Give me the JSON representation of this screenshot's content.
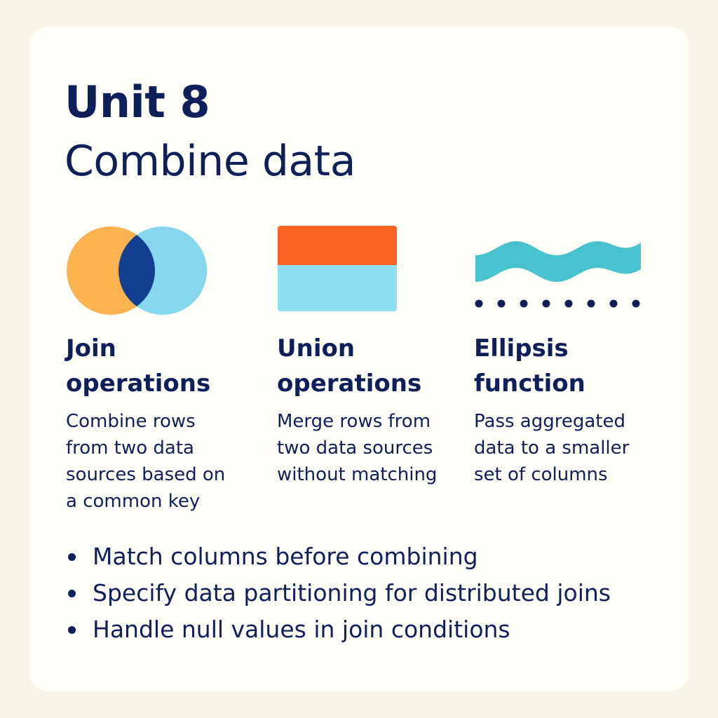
{
  "header": {
    "unit": "Unit 8",
    "title": "Combine data"
  },
  "columns": [
    {
      "icon": "venn-diagram-icon",
      "title": "Join\noperations",
      "description": "Combine rows\nfrom two data\nsources based on\na common key"
    },
    {
      "icon": "stacked-blocks-icon",
      "title": "Union\noperations",
      "description": "Merge rows from\ntwo data sources\nwithout matching"
    },
    {
      "icon": "wave-and-dots-icon",
      "title": "Ellipsis\nfunction",
      "description": "Pass aggregated\ndata to a smaller\nset of columns"
    }
  ],
  "bullets": [
    "Match columns before combining",
    "Specify data partitioning for distributed joins",
    "Handle null values in join conditions"
  ],
  "colors": {
    "text": "#0f1f5a",
    "orange_circle": "#fbb350",
    "blue_circle": "#86d7ee",
    "overlap": "#123f8f",
    "orange_block": "#fb6320",
    "blue_block": "#8ee0f0",
    "wave": "#48c2cc",
    "card": "#fefdf8",
    "background": "#f8f4e9"
  }
}
